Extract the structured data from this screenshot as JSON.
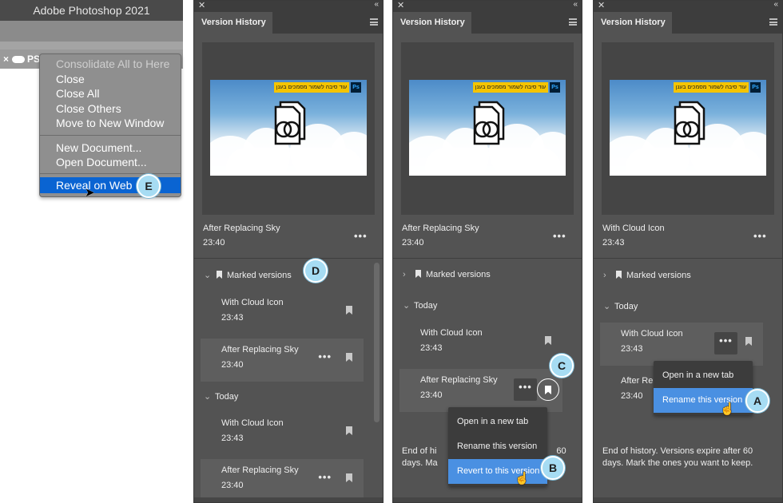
{
  "photoshop": {
    "app_title": "Adobe Photoshop 2021",
    "tab_label": "PS"
  },
  "context_menu": {
    "items": [
      {
        "label": "Consolidate All to Here",
        "disabled": true
      },
      {
        "label": "Close"
      },
      {
        "label": "Close All"
      },
      {
        "label": "Close Others"
      },
      {
        "label": "Move to New Window"
      },
      {
        "label": "New Document..."
      },
      {
        "label": "Open Document..."
      },
      {
        "label": "Reveal on Web",
        "selected": true
      }
    ]
  },
  "panel": {
    "tab_title": "Version History",
    "banner_text": "עוד סיבה לשמור מסמכים בענן",
    "ps_badge": "Ps",
    "section_marked": "Marked versions",
    "section_today": "Today",
    "end_of_history": "End of history. Versions expire after 60 days. Mark the ones you want to keep.",
    "end_partial_1": "End of hi",
    "end_partial_1b": "60",
    "end_partial_2": "days. Ma"
  },
  "panels": [
    {
      "current_name": "After Replacing Sky",
      "current_time": "23:40",
      "marked": [
        {
          "name": "With Cloud Icon",
          "time": "23:43"
        },
        {
          "name": "After Replacing Sky",
          "time": "23:40"
        }
      ],
      "today": [
        {
          "name": "With Cloud Icon",
          "time": "23:43"
        },
        {
          "name": "After Replacing Sky",
          "time": "23:40"
        }
      ]
    },
    {
      "current_name": "After Replacing Sky",
      "current_time": "23:40",
      "today": [
        {
          "name": "With Cloud Icon",
          "time": "23:43"
        },
        {
          "name": "After Replacing Sky",
          "time": "23:40"
        }
      ],
      "flyout": [
        "Open in a new tab",
        "Rename this version",
        "Revert to this version"
      ]
    },
    {
      "current_name": "With Cloud Icon",
      "current_time": "23:43",
      "today": [
        {
          "name": "With Cloud Icon",
          "time": "23:43"
        },
        {
          "name": "After Re",
          "time": "23:40"
        }
      ],
      "flyout": [
        "Open in a new tab",
        "Rename this version"
      ]
    }
  ],
  "callouts": {
    "a": "A",
    "b": "B",
    "c": "C",
    "d": "D",
    "e": "E"
  },
  "colors": {
    "panel_bg": "#535353",
    "menu_highlight": "#0a64d2",
    "flyout_highlight": "#4a90e2",
    "callout": "#a6dcf3"
  }
}
